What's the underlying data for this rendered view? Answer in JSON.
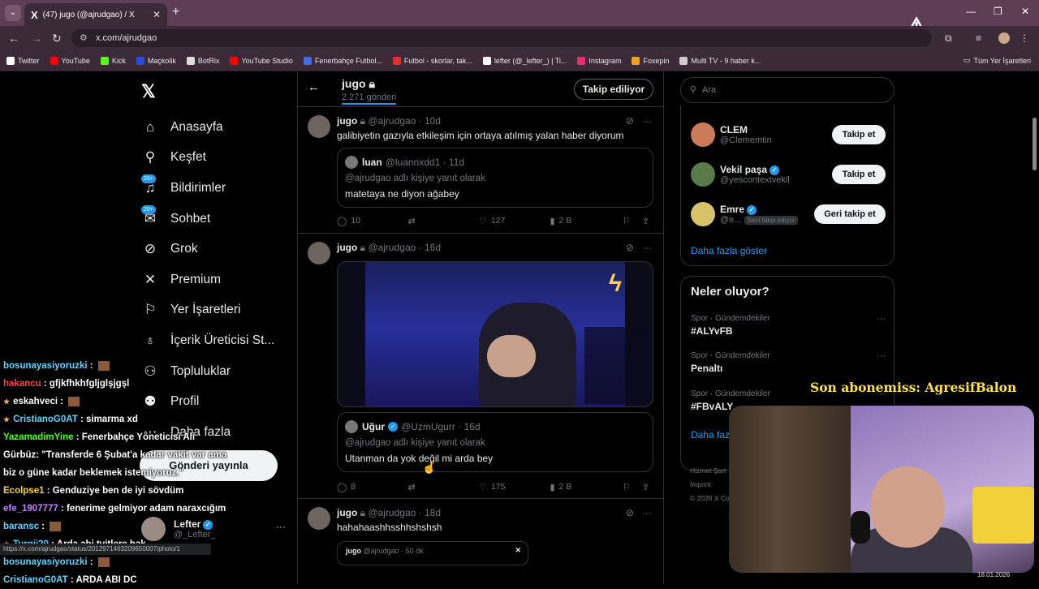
{
  "browser": {
    "tab_title": "(47) jugo (@ajrudgao) / X",
    "url": "x.com/ajrudgao",
    "bookmarks": [
      {
        "label": "Twitter",
        "icon": "x-icon",
        "color": "#ffffff"
      },
      {
        "label": "YouTube",
        "icon": "youtube-icon",
        "color": "#ff0000"
      },
      {
        "label": "Kick",
        "icon": "kick-icon",
        "color": "#53fc18"
      },
      {
        "label": "Maçkolik",
        "icon": "mackolik-icon",
        "color": "#2a4bd7"
      },
      {
        "label": "BotRix",
        "icon": "botrix-icon",
        "color": "#dddddd"
      },
      {
        "label": "YouTube Studio",
        "icon": "youtube-studio-icon",
        "color": "#ff0000"
      },
      {
        "label": "Fenerbahçe Futbol...",
        "icon": "fenerbahce-icon",
        "color": "#3f6ee8"
      },
      {
        "label": "Futbol - skorlar, tak...",
        "icon": "futbol-icon",
        "color": "#e03030"
      },
      {
        "label": "lefter (@_lefter_) | Ti...",
        "icon": "tiktok-icon",
        "color": "#ffffff"
      },
      {
        "label": "Instagram",
        "icon": "instagram-icon",
        "color": "#e1306c"
      },
      {
        "label": "Foxepin",
        "icon": "foxepin-icon",
        "color": "#f0a020"
      },
      {
        "label": "Multi TV - 9 haber k...",
        "icon": "multitv-icon",
        "color": "#cccccc"
      }
    ],
    "all_bookmarks": "Tüm Yer İşaretleri"
  },
  "sidebar": {
    "items": [
      {
        "label": "Anasayfa",
        "icon": "home-icon",
        "glyph": "⌂"
      },
      {
        "label": "Keşfet",
        "icon": "search-icon",
        "glyph": "⚲"
      },
      {
        "label": "Bildirimler",
        "icon": "bell-icon",
        "glyph": "♫",
        "badge": "20+"
      },
      {
        "label": "Sohbet",
        "icon": "mail-icon",
        "glyph": "✉",
        "badge": "20+"
      },
      {
        "label": "Grok",
        "icon": "grok-icon",
        "glyph": "⊘"
      },
      {
        "label": "Premium",
        "icon": "x-premium-icon",
        "glyph": "✕"
      },
      {
        "label": "Yer İşaretleri",
        "icon": "bookmark-icon",
        "glyph": "⚐"
      },
      {
        "label": "İçerik Üreticisi St...",
        "icon": "creator-studio-icon",
        "glyph": "♁"
      },
      {
        "label": "Topluluklar",
        "icon": "communities-icon",
        "glyph": "⚇"
      },
      {
        "label": "Profil",
        "icon": "profile-icon",
        "glyph": "⚉"
      },
      {
        "label": "Daha fazla",
        "icon": "more-icon",
        "glyph": "⋯"
      }
    ],
    "post_button": "Gönderi yayınla",
    "account": {
      "name": "Lefter",
      "handle": "@_Lefter_"
    }
  },
  "profile_header": {
    "name": "jugo",
    "post_count": "2.271 gönderi",
    "follow_button": "Takip ediliyor"
  },
  "tweets": [
    {
      "author": "jugo",
      "handle": "@ajrudgao",
      "time": "10d",
      "text": "galibiyetin gazıyla etkileşim için ortaya atılmış yalan haber diyorum",
      "quote": {
        "author": "luan",
        "handle": "@luannxdd1",
        "time": "11d",
        "reply_to": "@ajrudgao adlı kişiye yanıt olarak",
        "text": "matetaya ne diyon ağabey"
      },
      "replies": "10",
      "likes": "127",
      "views": "2 B"
    },
    {
      "author": "jugo",
      "handle": "@ajrudgao",
      "time": "16d",
      "text": "",
      "quote": {
        "author": "Uğur",
        "handle": "@UzmUgurr",
        "time": "16d",
        "reply_to": "@ajrudgao adlı kişiye yanıt olarak",
        "text": "Utanman da yok değil mi arda bey"
      },
      "replies": "8",
      "likes": "175",
      "views": "2 B"
    },
    {
      "author": "jugo",
      "handle": "@ajrudgao",
      "time": "18d",
      "text": "hahahaashhsshhshshsh",
      "embed_author": "jugo",
      "embed_meta": "@ajrudgao · 50 dk"
    }
  ],
  "right": {
    "search_placeholder": "Ara",
    "who_to_follow": [
      {
        "name": "CLEM",
        "handle": "@Clememtin",
        "button": "Takip et",
        "avatar_color": "#c97b5a"
      },
      {
        "name": "Vekil paşa",
        "handle": "@yescontextvekil",
        "button": "Takip et",
        "avatar_color": "#5a7a4a"
      },
      {
        "name": "Emre",
        "handle": "@e...",
        "button": "Geri takip et",
        "follows_you": "Seni takip ediyor",
        "avatar_color": "#d9c36a"
      }
    ],
    "show_more": "Daha fazla göster",
    "trends_title": "Neler oluyor?",
    "trends": [
      {
        "category": "Spor · Gündemdekiler",
        "name": "#ALYvFB"
      },
      {
        "category": "Spor · Gündemdekiler",
        "name": "Penaltı"
      },
      {
        "category": "Spor · Gündemdekiler",
        "name": "#FBvALY"
      }
    ],
    "trends_more": "Daha faz",
    "footer": [
      "Hizmet Şart",
      "İmprint",
      "© 2026 X Co"
    ]
  },
  "overlay": {
    "subscriber": "Son abonemiss: AgresifBalon",
    "chat": [
      {
        "user": "bosunayasiyoruzki",
        "color": "#5fd3ff",
        "msg": "",
        "badge": true
      },
      {
        "user": "hakancu",
        "color": "#ff4040",
        "msg": "gfjkfhkhfgljglşjgşl"
      },
      {
        "user": "eskahveci",
        "color": "#ffffff",
        "msg": "",
        "badge": true,
        "star": true
      },
      {
        "user": "CristianoG0AT",
        "color": "#5fd3ff",
        "msg": "simarma xd",
        "star": true
      },
      {
        "user": "YazamadimYine",
        "color": "#53fc18",
        "msg": "Fenerbahçe Yöneticisi Ali"
      },
      {
        "user": "",
        "color": "#ffffff",
        "msg": "Gürbüz: \"Transferde 6 Şubat'a kadar vakit var ama"
      },
      {
        "user": "",
        "color": "#ffffff",
        "msg": "biz o güne kadar beklemek istemiyoruz.\""
      },
      {
        "user": "Ecolpse1",
        "color": "#f5d442",
        "msg": "Genduziye ben de iyi sövdüm"
      },
      {
        "user": "efe_1907777",
        "color": "#c084fc",
        "msg": "fenerime gelmiyor adam naraxcığım"
      },
      {
        "user": "baransc",
        "color": "#5fd3ff",
        "msg": "",
        "badge": true
      },
      {
        "user": "Turgii20",
        "color": "#5fd3ff",
        "msg": "Arda abi tvitlere bak",
        "star": true
      },
      {
        "user": "bosunayasiyoruzki",
        "color": "#5fd3ff",
        "msg": "",
        "badge": true
      },
      {
        "user": "CristianoG0AT",
        "color": "#5fd3ff",
        "msg": "ARDA ABI DC"
      }
    ],
    "status_url": "https://x.com/ajrudgao/status/2012971463209650007/photo/1",
    "date": "18.01.2026"
  }
}
